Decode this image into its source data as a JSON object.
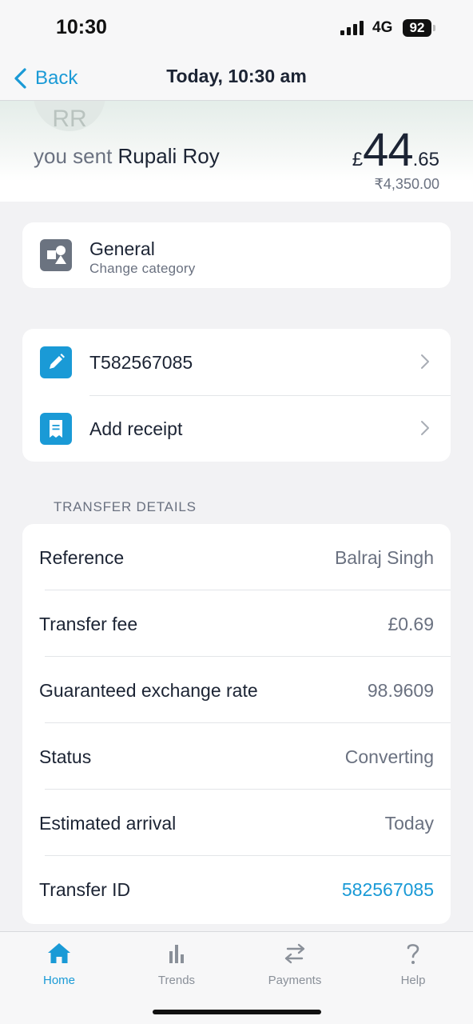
{
  "status_bar": {
    "time": "10:30",
    "network": "4G",
    "battery": "92"
  },
  "nav": {
    "back_label": "Back",
    "title": "Today, 10:30 am"
  },
  "header": {
    "avatar_initials": "RR",
    "sent_prefix": "you sent",
    "recipient": "Rupali Roy",
    "amount_currency": "£",
    "amount_major": "44",
    "amount_minor": ".65",
    "converted_amount": "₹4,350.00"
  },
  "category": {
    "title": "General",
    "subtitle": "Change category",
    "icon": "category-shapes-icon"
  },
  "actions": [
    {
      "label": "T582567085",
      "icon": "pencil-icon"
    },
    {
      "label": "Add receipt",
      "icon": "receipt-icon"
    }
  ],
  "transfer_details": {
    "section_title": "TRANSFER DETAILS",
    "rows": [
      {
        "label": "Reference",
        "value": "Balraj Singh"
      },
      {
        "label": "Transfer fee",
        "value": "£0.69"
      },
      {
        "label": "Guaranteed exchange rate",
        "value": "98.9609"
      },
      {
        "label": "Status",
        "value": "Converting"
      },
      {
        "label": "Estimated arrival",
        "value": "Today"
      },
      {
        "label": "Transfer ID",
        "value": "582567085"
      }
    ]
  },
  "tabs": [
    {
      "label": "Home",
      "icon": "home-icon",
      "active": true
    },
    {
      "label": "Trends",
      "icon": "bar-chart-icon",
      "active": false
    },
    {
      "label": "Payments",
      "icon": "transfer-arrows-icon",
      "active": false
    },
    {
      "label": "Help",
      "icon": "question-mark-icon",
      "active": false
    }
  ],
  "colors": {
    "accent": "#1a9ad6",
    "text_primary": "#1c2434",
    "text_secondary": "#6a7180",
    "background": "#f2f2f4"
  }
}
